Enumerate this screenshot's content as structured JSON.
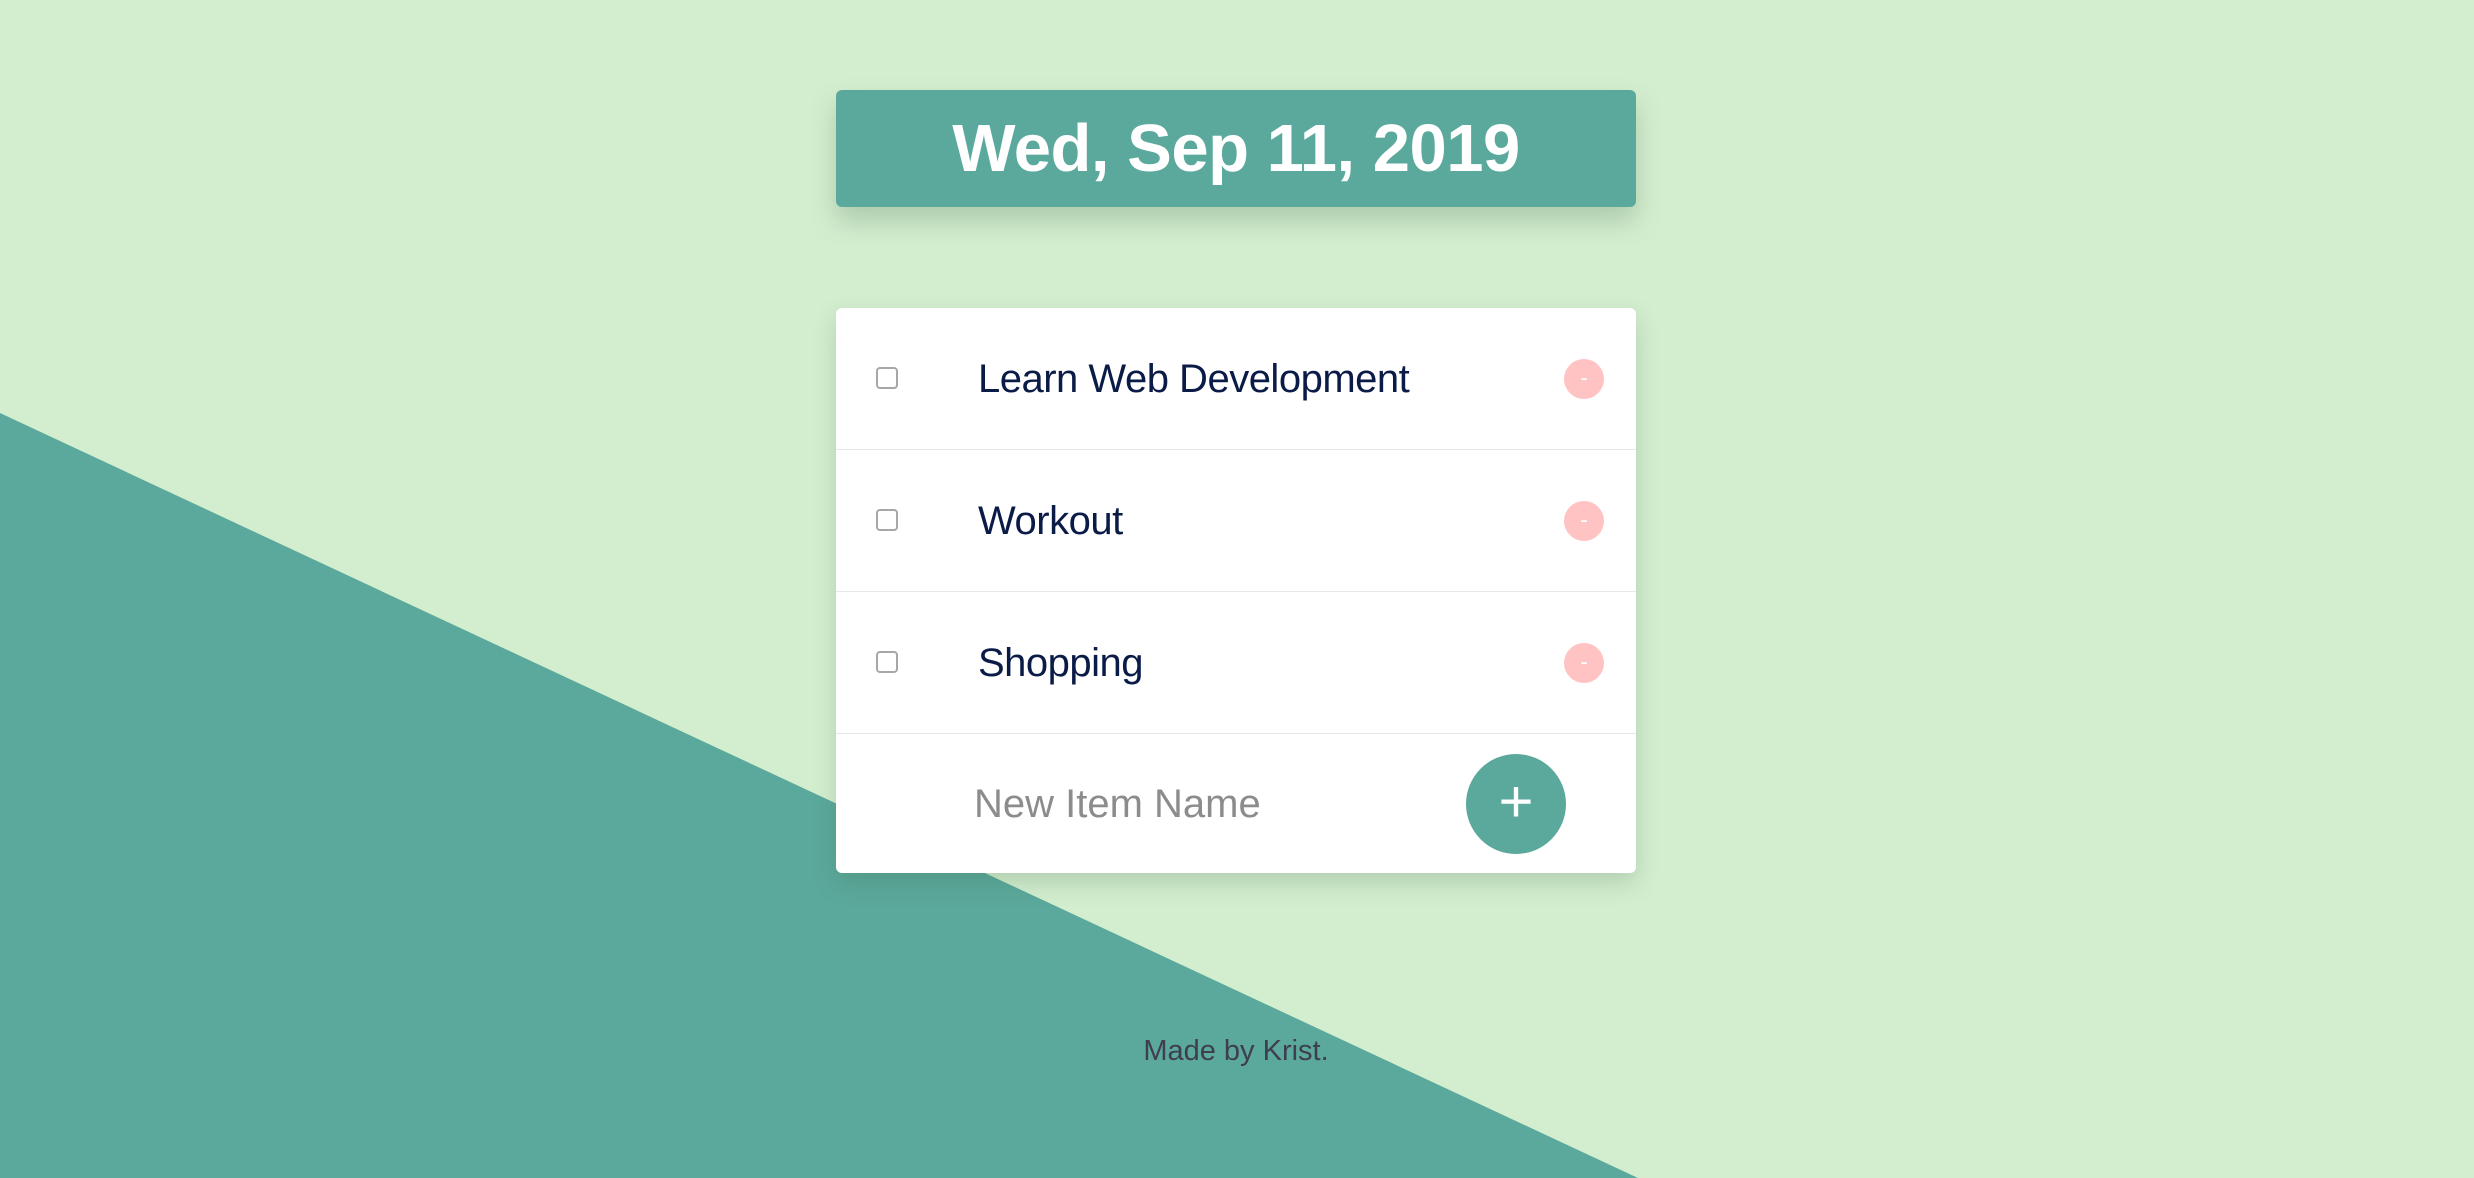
{
  "colors": {
    "background_light": "#d3eecf",
    "accent_teal": "#5ba99c",
    "delete_pink": "#ffc3c3",
    "item_text": "#0b1b47"
  },
  "header": {
    "date": "Wed, Sep 11, 2019"
  },
  "todo_list": {
    "items": [
      {
        "label": "Learn Web Development",
        "checked": false,
        "delete_label": "-"
      },
      {
        "label": "Workout",
        "checked": false,
        "delete_label": "-"
      },
      {
        "label": "Shopping",
        "checked": false,
        "delete_label": "-"
      }
    ],
    "new_item": {
      "placeholder": "New Item Name",
      "value": "",
      "add_label": "+"
    }
  },
  "footer": {
    "text": "Made by Krist."
  }
}
